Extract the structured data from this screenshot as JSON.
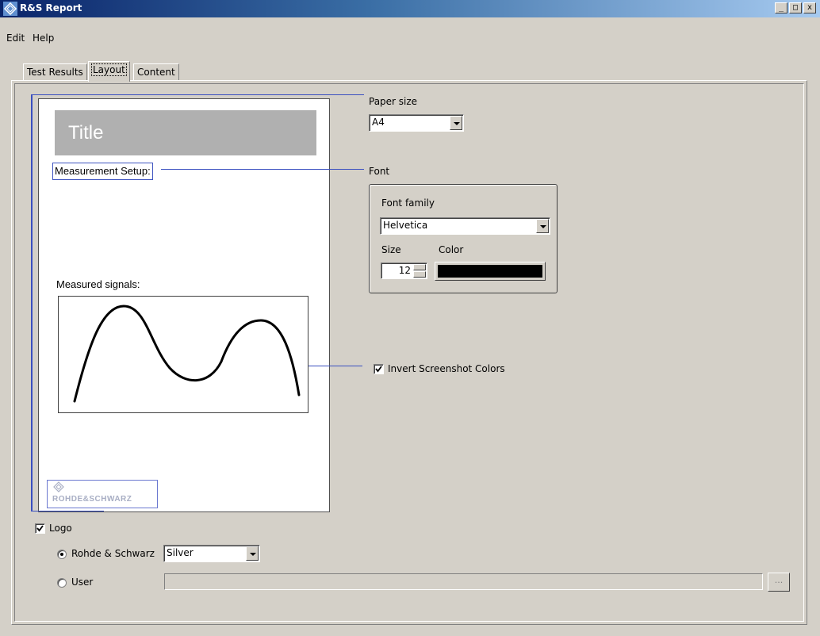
{
  "window": {
    "title": "R&S Report",
    "minimize": "_",
    "maximize": "□",
    "close": "x"
  },
  "menu": [
    "Edit",
    "Help"
  ],
  "tabs": [
    {
      "label": "Test Results",
      "active": false
    },
    {
      "label": "Layout",
      "active": true
    },
    {
      "label": "Content",
      "active": false
    }
  ],
  "preview": {
    "title": "Title",
    "measurement_setup": "Measurement Setup:",
    "measured_signals": "Measured signals:",
    "logo_text": "ROHDE&SCHWARZ"
  },
  "paper": {
    "label": "Paper size",
    "value": "A4"
  },
  "font": {
    "section_label": "Font",
    "family_label": "Font family",
    "family_value": "Helvetica",
    "size_label": "Size",
    "size_value": "12",
    "color_label": "Color",
    "color_value": "#000000"
  },
  "invert": {
    "label": "Invert Screenshot Colors",
    "checked": true
  },
  "logo": {
    "label": "Logo",
    "checked": true,
    "rs_label": "Rohde & Schwarz",
    "rs_selected": true,
    "rs_variant": "Silver",
    "user_label": "User",
    "user_path": "",
    "browse_label": "..."
  },
  "colors": {
    "titlebar_start": "#0a246a",
    "leader_lines": "#3a4fc0",
    "face": "#d4d0c8"
  }
}
